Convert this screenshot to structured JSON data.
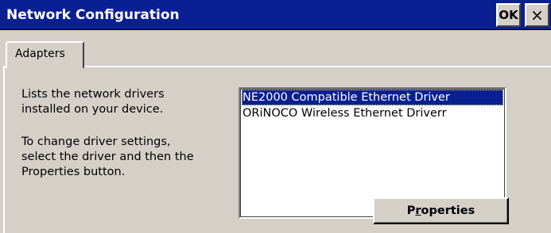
{
  "window": {
    "title": "Network Configuration",
    "ok_label": "OK",
    "close_label": "×"
  },
  "tabs": [
    {
      "label": "Adapters",
      "selected": true
    }
  ],
  "description": {
    "line1": "Lists the network drivers",
    "line2": "installed on your device.",
    "line3": "To change driver settings,",
    "line4": "select the driver and then the",
    "line5": "Properties button."
  },
  "adapters": {
    "items": [
      {
        "label": "NE2000 Compatible Ethernet Driver",
        "selected": true
      },
      {
        "label": "ORiNOCO Wireless Ethernet Driverr",
        "selected": false
      }
    ]
  },
  "properties_button": {
    "prefix": "P",
    "accel": "r",
    "suffix": "operties"
  },
  "colors": {
    "titlebar": "#0a1f91",
    "face": "#d4d0c8",
    "selection": "#0a1f91"
  }
}
